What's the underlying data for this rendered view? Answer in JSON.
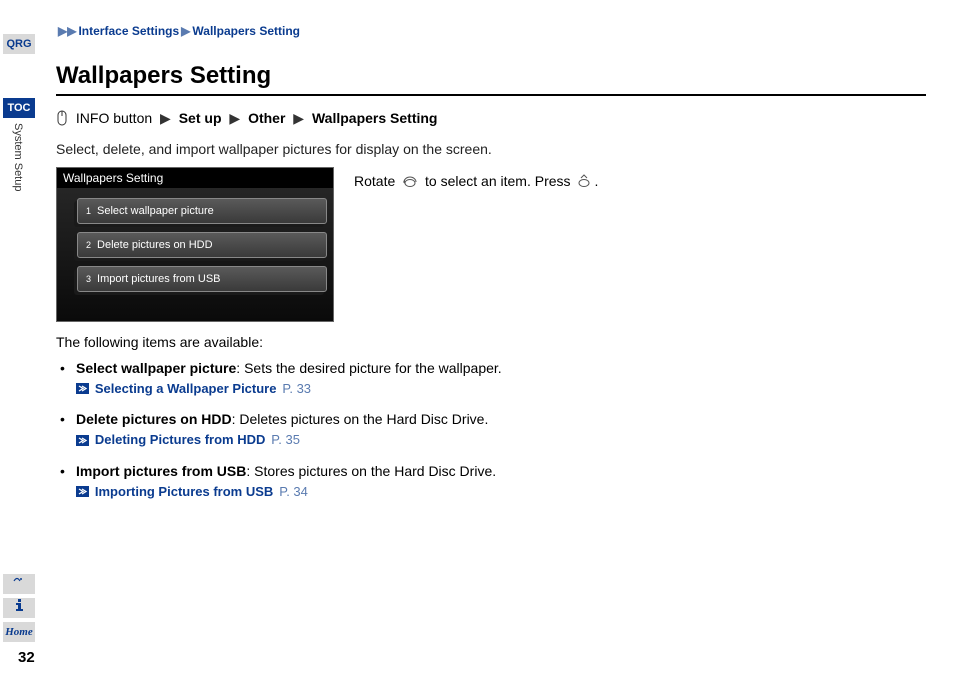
{
  "sidebar": {
    "qrg": "QRG",
    "toc": "TOC",
    "section": "System Setup",
    "home": "Home"
  },
  "page_number": "32",
  "breadcrumb": {
    "a": "Interface Settings",
    "b": "Wallpapers Setting"
  },
  "title": "Wallpapers Setting",
  "nav_path": {
    "info": "INFO button",
    "setup": "Set up",
    "other": "Other",
    "ws": "Wallpapers Setting"
  },
  "intro": "Select, delete, and import wallpaper pictures for display on the screen.",
  "screenshot": {
    "title": "Wallpapers Setting",
    "items": [
      {
        "num": "1",
        "label": "Select wallpaper picture"
      },
      {
        "num": "2",
        "label": "Delete pictures on HDD"
      },
      {
        "num": "3",
        "label": "Import pictures from USB"
      }
    ]
  },
  "rotate": {
    "pre": "Rotate",
    "mid": "to select an item. Press",
    "post": "."
  },
  "avail": "The following items are available:",
  "items": [
    {
      "title": "Select wallpaper picture",
      "desc": ": Sets the desired picture for the wallpaper.",
      "link": "Selecting a Wallpaper Picture",
      "page": "P. 33"
    },
    {
      "title": "Delete pictures on HDD",
      "desc": ": Deletes pictures on the Hard Disc Drive.",
      "link": "Deleting Pictures from HDD",
      "page": "P. 35"
    },
    {
      "title": "Import pictures from USB",
      "desc": ": Stores pictures on the Hard Disc Drive.",
      "link": "Importing Pictures from USB",
      "page": "P. 34"
    }
  ]
}
